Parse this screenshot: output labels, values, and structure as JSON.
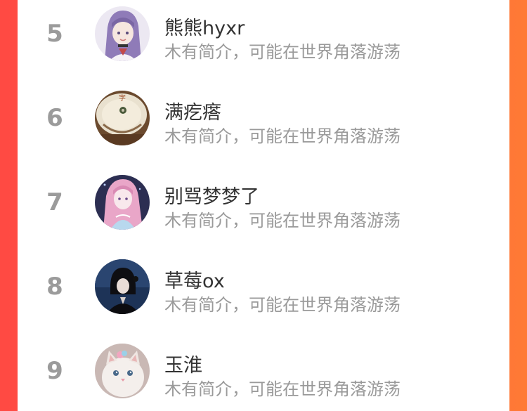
{
  "colors": {
    "background_left": "#ff4a43",
    "background_right": "#ff7a35",
    "rank_color": "#9b9b9b",
    "name_color": "#333333",
    "bio_color": "#9a9a9a"
  },
  "ranking": {
    "rows": [
      {
        "rank": "5",
        "name": "熊熊hyxr",
        "bio": "木有简介，可能在世界角落游荡",
        "avatar": "anime-girl-purple-hair-avatar"
      },
      {
        "rank": "6",
        "name": "满疙瘩",
        "bio": "木有简介，可能在世界角落游荡",
        "avatar": "ceramic-plate-avatar"
      },
      {
        "rank": "7",
        "name": "别骂梦梦了",
        "bio": "木有简介，可能在世界角落游荡",
        "avatar": "anime-girl-pink-hair-avatar"
      },
      {
        "rank": "8",
        "name": "草莓ox",
        "bio": "木有简介，可能在世界角落游荡",
        "avatar": "dark-portrait-avatar"
      },
      {
        "rank": "9",
        "name": "玉淮",
        "bio": "木有简介，可能在世界角落游荡",
        "avatar": "white-kitten-avatar"
      }
    ]
  }
}
